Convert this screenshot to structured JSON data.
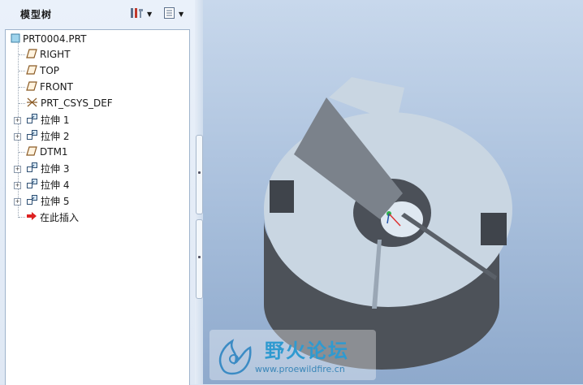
{
  "model_tree": {
    "title": "模型树",
    "settings_icon": "tree-settings-icon",
    "show_icon": "tree-show-icon",
    "items": [
      {
        "label": "PRT0004.PRT",
        "icon": "part-icon"
      },
      {
        "label": "RIGHT",
        "icon": "datum-plane-icon"
      },
      {
        "label": "TOP",
        "icon": "datum-plane-icon"
      },
      {
        "label": "FRONT",
        "icon": "datum-plane-icon"
      },
      {
        "label": "PRT_CSYS_DEF",
        "icon": "csys-icon"
      },
      {
        "label": "拉伸 1",
        "icon": "extrude-icon"
      },
      {
        "label": "拉伸 2",
        "icon": "extrude-icon"
      },
      {
        "label": "DTM1",
        "icon": "datum-plane-icon"
      },
      {
        "label": "拉伸 3",
        "icon": "extrude-icon"
      },
      {
        "label": "拉伸 4",
        "icon": "extrude-icon"
      },
      {
        "label": "拉伸 5",
        "icon": "extrude-icon"
      },
      {
        "label": "在此插入",
        "icon": "insert-here-arrow-icon"
      }
    ]
  },
  "watermark": {
    "title": "野火论坛",
    "url": "www.proewildfire.cn"
  },
  "colors": {
    "model_face": "#c9d6e2",
    "model_side": "#4d5259",
    "viewport_top": "#c8d8ec",
    "viewport_bottom": "#8ea9cc"
  }
}
